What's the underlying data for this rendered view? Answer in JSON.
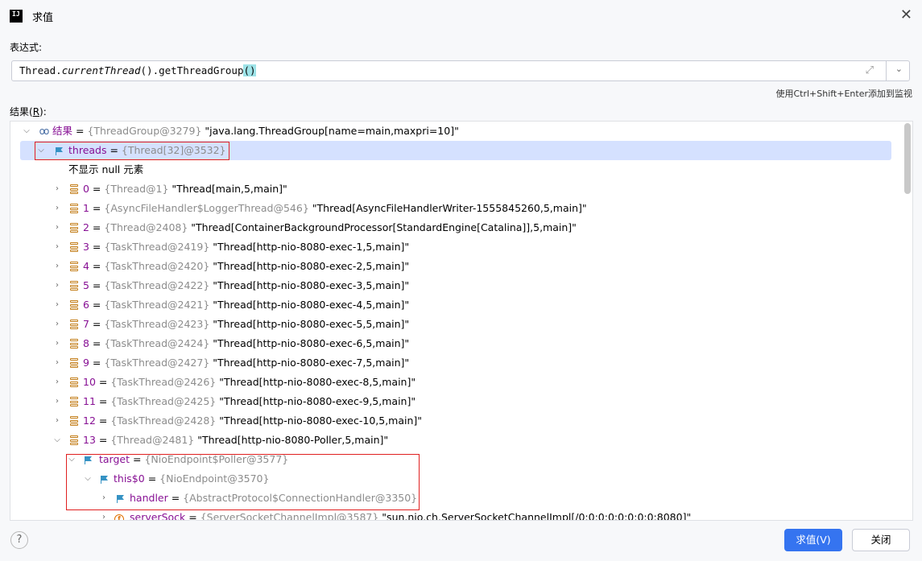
{
  "window": {
    "title": "求值",
    "logo_text": "IJ"
  },
  "expression": {
    "label": "表达式:",
    "code_prefix": "Thread.",
    "code_italic": "currentThread",
    "code_middle": "().getThreadGroup",
    "code_paren": "()"
  },
  "hint": "使用Ctrl+Shift+Enter添加到监视",
  "result_label": {
    "text_before": "结果(",
    "mnemonic": "R",
    "text_after": "):"
  },
  "tree": {
    "root": {
      "name": "结果",
      "eq": " = ",
      "type": "{ThreadGroup@3279}",
      "value": " \"java.lang.ThreadGroup[name=main,maxpri=10]\""
    },
    "threads": {
      "name": "threads",
      "eq": " = ",
      "type": "{Thread[32]@3532}"
    },
    "null_notice": "不显示 null 元素",
    "items": [
      {
        "index": "0",
        "type": "{Thread@1}",
        "value": " \"Thread[main,5,main]\""
      },
      {
        "index": "1",
        "type": "{AsyncFileHandler$LoggerThread@546}",
        "value": " \"Thread[AsyncFileHandlerWriter-1555845260,5,main]\""
      },
      {
        "index": "2",
        "type": "{Thread@2408}",
        "value": " \"Thread[ContainerBackgroundProcessor[StandardEngine[Catalina]],5,main]\""
      },
      {
        "index": "3",
        "type": "{TaskThread@2419}",
        "value": " \"Thread[http-nio-8080-exec-1,5,main]\""
      },
      {
        "index": "4",
        "type": "{TaskThread@2420}",
        "value": " \"Thread[http-nio-8080-exec-2,5,main]\""
      },
      {
        "index": "5",
        "type": "{TaskThread@2422}",
        "value": " \"Thread[http-nio-8080-exec-3,5,main]\""
      },
      {
        "index": "6",
        "type": "{TaskThread@2421}",
        "value": " \"Thread[http-nio-8080-exec-4,5,main]\""
      },
      {
        "index": "7",
        "type": "{TaskThread@2423}",
        "value": " \"Thread[http-nio-8080-exec-5,5,main]\""
      },
      {
        "index": "8",
        "type": "{TaskThread@2424}",
        "value": " \"Thread[http-nio-8080-exec-6,5,main]\""
      },
      {
        "index": "9",
        "type": "{TaskThread@2427}",
        "value": " \"Thread[http-nio-8080-exec-7,5,main]\""
      },
      {
        "index": "10",
        "type": "{TaskThread@2426}",
        "value": " \"Thread[http-nio-8080-exec-8,5,main]\""
      },
      {
        "index": "11",
        "type": "{TaskThread@2425}",
        "value": " \"Thread[http-nio-8080-exec-9,5,main]\""
      },
      {
        "index": "12",
        "type": "{TaskThread@2428}",
        "value": " \"Thread[http-nio-8080-exec-10,5,main]\""
      },
      {
        "index": "13",
        "type": "{Thread@2481}",
        "value": " \"Thread[http-nio-8080-Poller,5,main]\""
      }
    ],
    "target": {
      "name": "target",
      "eq": " = ",
      "type": "{NioEndpoint$Poller@3577}"
    },
    "this0": {
      "name": "this$0",
      "eq": " = ",
      "type": "{NioEndpoint@3570}"
    },
    "handler": {
      "name": "handler",
      "eq": " = ",
      "type": "{AbstractProtocol$ConnectionHandler@3350}"
    },
    "server_sock": {
      "name": "serverSock",
      "eq": " = ",
      "type": "{ServerSocketChannelImpl@3587}",
      "value": " \"sun.nio.ch.ServerSocketChannelImpl[/0:0:0:0:0:0:0:0:8080]\""
    }
  },
  "buttons": {
    "help": "?",
    "evaluate": "求值(V)",
    "close": "关闭"
  },
  "colors": {
    "accent": "#3574f0",
    "selection": "#d5e1ff",
    "annotation_box": "#e02020",
    "field_name": "#871094",
    "type_gray": "#8c8c8c"
  },
  "icons": {
    "close": "close-icon",
    "expand": "expand-icon",
    "history": "chevron-down-icon",
    "flag": "flag-icon",
    "array_element": "stack-icon",
    "field": "field-icon",
    "watch": "glasses-icon"
  }
}
